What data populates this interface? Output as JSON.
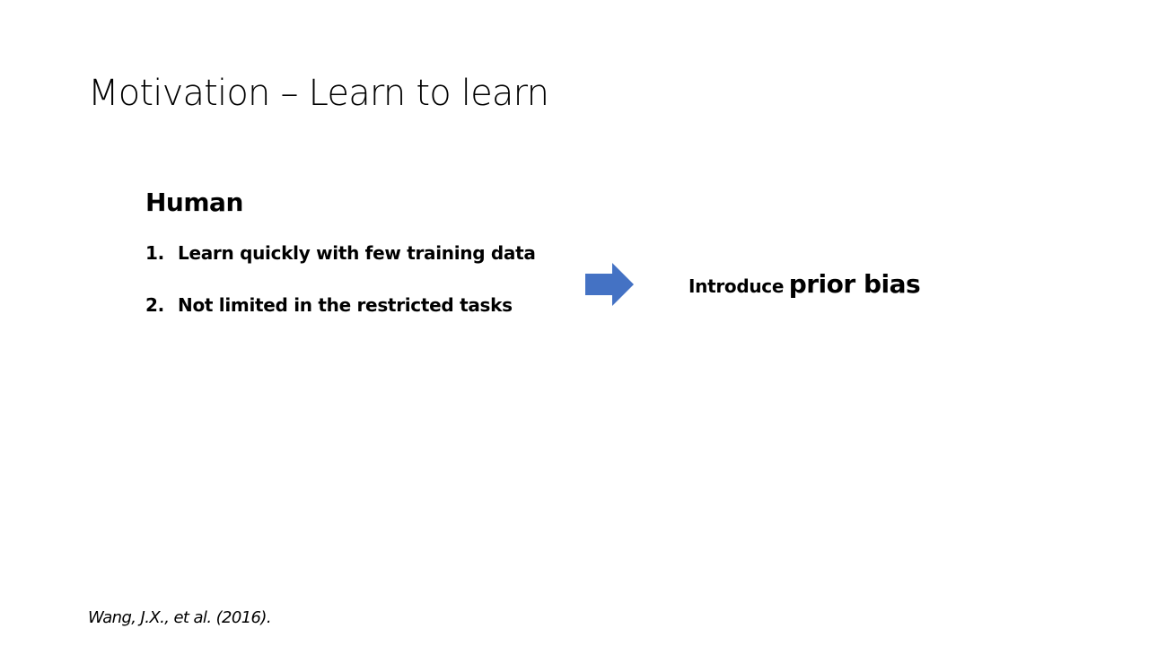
{
  "slide": {
    "title": "Motivation – Learn to learn",
    "heading": "Human",
    "items": [
      {
        "number": "1.",
        "text": "Learn quickly with few training data"
      },
      {
        "number": "2.",
        "text": "Not limited in the restricted tasks"
      }
    ],
    "arrow_icon": "right-arrow-icon",
    "arrow_color": "#4472C4",
    "conclusion": {
      "prefix": "Introduce",
      "emphasis": "prior bias"
    },
    "citation": "Wang, J.X., et al. (2016)."
  }
}
